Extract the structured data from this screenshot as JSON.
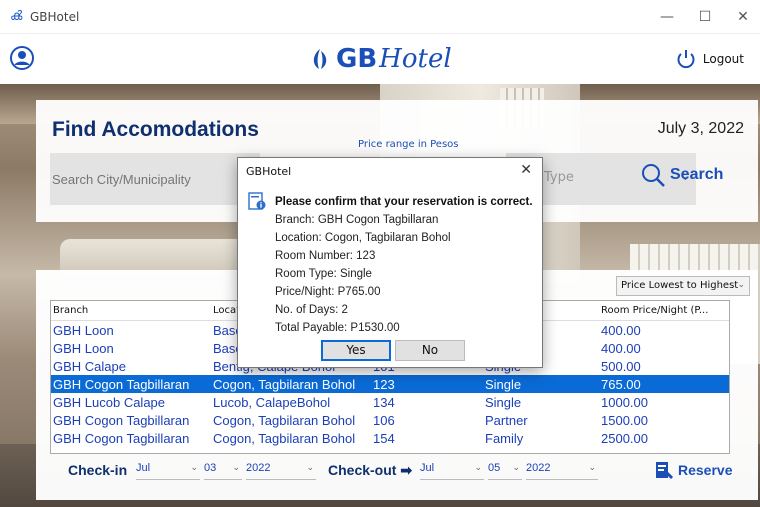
{
  "window": {
    "title": "GBHotel"
  },
  "header": {
    "logo_bold": "GB",
    "logo_italic": "Hotel",
    "logout_label": "Logout"
  },
  "search": {
    "heading": "Find Accomodations",
    "date": "July 3, 2022",
    "price_range_label": "Price range in Pesos",
    "city_placeholder": "Search City/Municipality",
    "room_type_placeholder": "Type",
    "search_label": "Search"
  },
  "results": {
    "sort_selected": "Price Lowest to Highest",
    "columns": [
      "Branch",
      "Locat",
      "",
      "",
      "Room Price/Night (P..."
    ],
    "rows": [
      {
        "branch": "GBH Loon",
        "location": "Basc",
        "room": "",
        "type": "",
        "price": "400.00"
      },
      {
        "branch": "GBH Loon",
        "location": "Basc",
        "room": "",
        "type": "",
        "price": "400.00"
      },
      {
        "branch": "GBH Calape",
        "location": "Bentig, Calape Bohol",
        "room": "101",
        "type": "Single",
        "price": "500.00"
      },
      {
        "branch": "GBH Cogon Tagbillaran",
        "location": "Cogon, Tagbilaran Bohol",
        "room": "123",
        "type": "Single",
        "price": "765.00",
        "selected": true
      },
      {
        "branch": "GBH Lucob Calape",
        "location": "Lucob, CalapeBohol",
        "room": "134",
        "type": "Single",
        "price": "1000.00"
      },
      {
        "branch": "GBH Cogon Tagbillaran",
        "location": "Cogon, Tagbilaran Bohol",
        "room": "106",
        "type": "Partner",
        "price": "1500.00"
      },
      {
        "branch": "GBH Cogon Tagbillaran",
        "location": "Cogon, Tagbilaran Bohol",
        "room": "154",
        "type": "Family",
        "price": "2500.00"
      }
    ],
    "checkin_label": "Check-in",
    "checkin": {
      "month": "Jul",
      "day": "03",
      "year": "2022"
    },
    "checkout_label": "Check-out ➡",
    "checkout": {
      "month": "Jul",
      "day": "05",
      "year": "2022"
    },
    "reserve_label": "Reserve"
  },
  "dialog": {
    "title": "GBHotel",
    "heading": "Please confirm that your reservation is correct.",
    "lines": [
      "Branch: GBH Cogon Tagbillaran",
      "Location: Cogon, Tagbilaran Bohol",
      "Room Number: 123",
      "Room Type: Single",
      "Price/Night: P765.00",
      "No. of Days: 2",
      "Total Payable: P1530.00"
    ],
    "yes_label": "Yes",
    "no_label": "No"
  },
  "colors": {
    "accent": "#1a4fb8",
    "selection": "#0a6bd7",
    "heading": "#0f2f6e"
  }
}
